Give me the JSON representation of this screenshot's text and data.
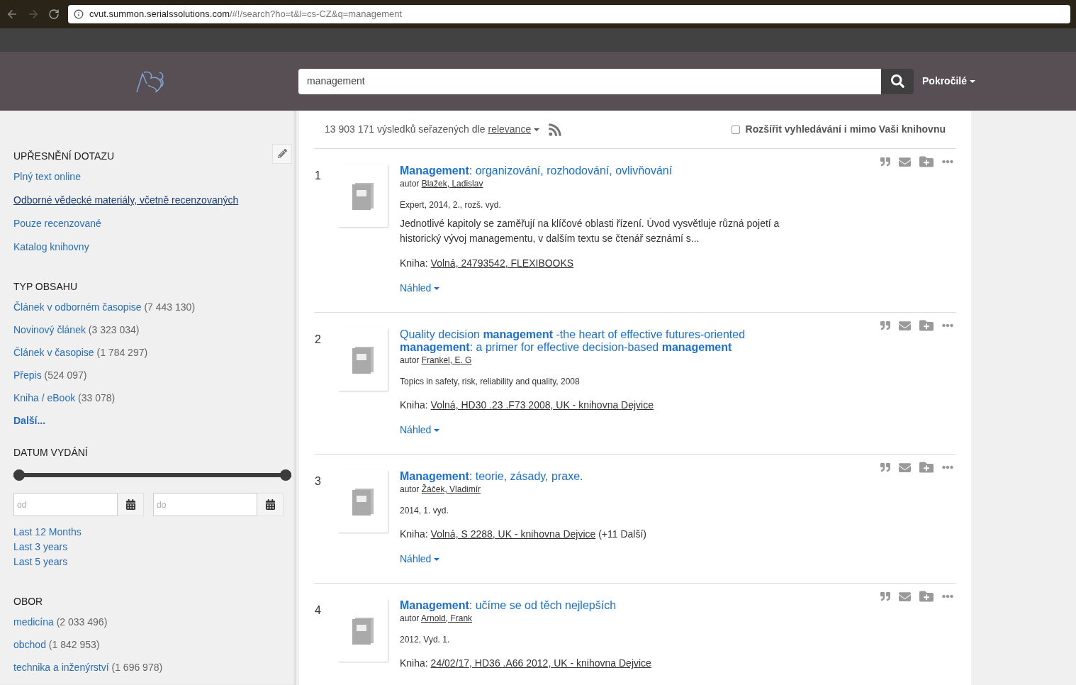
{
  "browser": {
    "url_host": "cvut.summon.serialssolutions.com",
    "url_path": "/#!/search?ho=t&l=cs-CZ&q=management"
  },
  "header": {
    "search_value": "management",
    "advanced_label": "Pokročilé"
  },
  "refine": {
    "title": "UPŘESNĚNÍ DOTAZU",
    "items": [
      {
        "label": "Plný text online",
        "selected": false
      },
      {
        "label": "Odborné vědecké materiály, včetně recenzovaných",
        "selected": true
      },
      {
        "label": "Pouze recenzované",
        "selected": false
      },
      {
        "label": "Katalog knihovny",
        "selected": false
      }
    ]
  },
  "content_type": {
    "title": "TYP OBSAHU",
    "items": [
      {
        "label": "Článek v odborném časopise",
        "count": "(7 443 130)"
      },
      {
        "label": "Novinový článek",
        "count": "(3 323 034)"
      },
      {
        "label": "Článek v časopise",
        "count": "(1 784 297)"
      },
      {
        "label": "Přepis",
        "count": "(524 097)"
      },
      {
        "label": "Kniha / eBook",
        "count": "(33 078)"
      }
    ],
    "more": "Další..."
  },
  "date": {
    "title": "DATUM VYDÁNÍ",
    "range_start": {
      "level": 0
    },
    "range_end": {
      "level": 1
    },
    "from_placeholder": "od",
    "to_placeholder": "do",
    "presets": [
      "Last 12 Months",
      "Last 3 years",
      "Last 5 years"
    ]
  },
  "field": {
    "title": "OBOR",
    "items": [
      {
        "label": "medicína",
        "count": "(2 033 496)"
      },
      {
        "label": "obchod",
        "count": "(1 842 953)"
      },
      {
        "label": "technika a inženýrství",
        "count": "(1 696 978)"
      }
    ]
  },
  "results": {
    "summary": "13 903 171 výsledků seřazených dle",
    "sort": "relevance",
    "expand": {
      "label": "Rozšířit vyhledávání i mimo Vaši knihovnu",
      "checked": false
    },
    "items": [
      {
        "number": "1",
        "title": "**Management**: organizování, rozhodování, ovlivňování",
        "author_prefix": "autor",
        "author": "Blažek, Ladislav",
        "meta": "Expert, 2014, 2., rozš. vyd.",
        "description": "Jednotlivé kapitoly se zaměřují na klíčové oblasti řízení. Úvod vysvětluje různá pojetí a historický vývoj managementu, v dalším textu se čtenář seznámí s...",
        "holding_prefix": "Kniha:",
        "holding": "Volná, 24793542, FLEXIBOOKS",
        "preview": "Náhled"
      },
      {
        "number": "2",
        "title": "Quality decision **management** -the heart of effective futures-oriented **management**: a primer for effective decision-based **management**",
        "author_prefix": "autor",
        "author": "Frankel, E. G",
        "meta": "Topics in safety, risk, reliability and quality, 2008",
        "holding_prefix": "Kniha:",
        "holding": "Volná, HD30 .23 .F73 2008, UK - knihovna Dejvice",
        "preview": "Náhled"
      },
      {
        "number": "3",
        "title": "**Management**: teorie, zásady, praxe.",
        "author_prefix": "autor",
        "author": "Žáček, Vladimír",
        "meta": "2014, 1. vyd.",
        "holding_prefix": "Kniha:",
        "holding": "Volná, S 2288, UK - knihovna Dejvice",
        "holding_extra": "(+11 Další)",
        "preview": "Náhled"
      },
      {
        "number": "4",
        "title": "**Management**: učíme se od těch nejlepších",
        "author_prefix": "autor",
        "author": "Arnold, Frank",
        "meta": "2012, Vyd. 1.",
        "holding_prefix": "Kniha:",
        "holding": "24/02/17, HD36 .A66 2012, UK - knihovna Dejvice"
      }
    ]
  }
}
